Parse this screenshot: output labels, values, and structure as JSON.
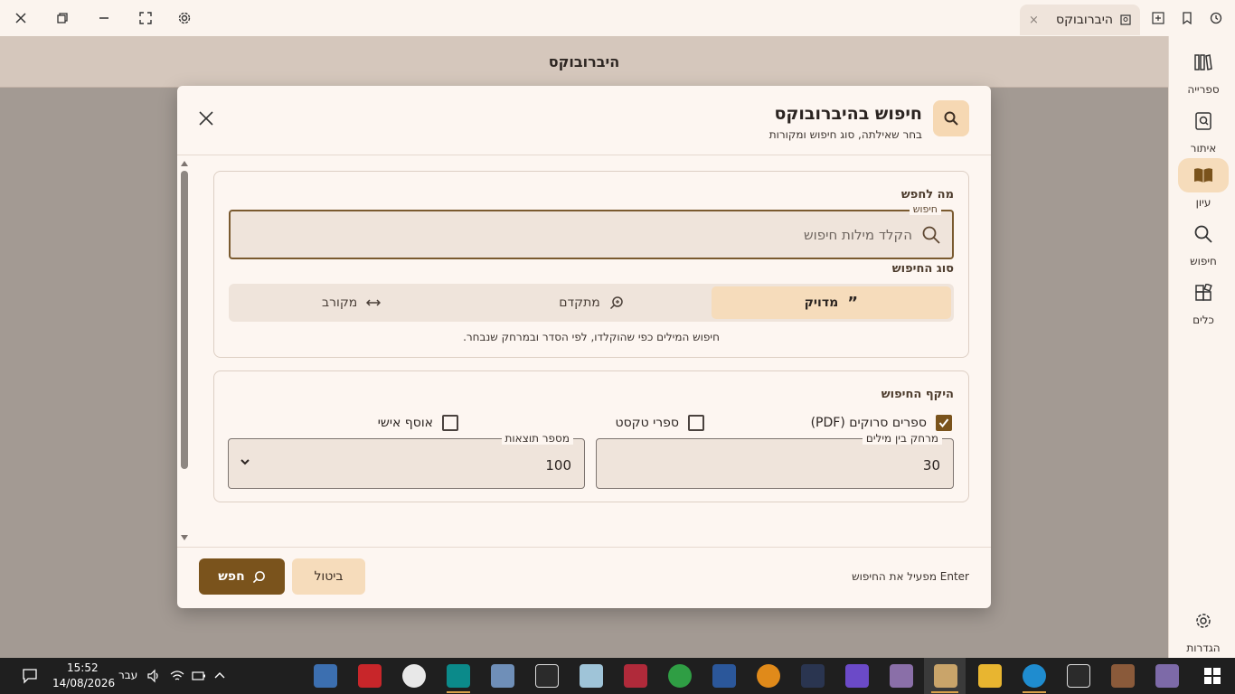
{
  "window": {
    "tab_title": "היברובוקס",
    "tab_close": "×"
  },
  "app": {
    "header_title": "היברובוקס"
  },
  "rail": {
    "items": [
      {
        "label": "ספרייה",
        "icon": "library-icon"
      },
      {
        "label": "איתור",
        "icon": "locate-icon"
      },
      {
        "label": "עיון",
        "icon": "open-book-icon",
        "active": true
      },
      {
        "label": "חיפוש",
        "icon": "search-icon"
      },
      {
        "label": "כלים",
        "icon": "tools-icon"
      }
    ],
    "settings_label": "הגדרות"
  },
  "dialog": {
    "title": "חיפוש בהיברובוקס",
    "subtitle": "בחר שאילתה, סוג חיפוש ומקורות",
    "query_section": {
      "label": "מה לחפש",
      "field_legend": "חיפוש",
      "placeholder": "הקלד מילות חיפוש",
      "value": ""
    },
    "type_section": {
      "label": "סוג החיפוש",
      "options": [
        {
          "label": "מדויק",
          "icon": "quote-icon",
          "selected": true
        },
        {
          "label": "מתקדם",
          "icon": "zoom-search-icon",
          "selected": false
        },
        {
          "label": "מקורב",
          "icon": "arrows-horizontal-icon",
          "selected": false
        }
      ],
      "help": "חיפוש המילים כפי שהוקלדו, לפי הסדר ובמרחק שנבחר."
    },
    "scope_section": {
      "label": "היקף החיפוש",
      "sources": [
        {
          "label": "ספרים סרוקים (PDF)",
          "checked": true
        },
        {
          "label": "ספרי טקסט",
          "checked": false
        },
        {
          "label": "אוסף אישי",
          "checked": false
        }
      ],
      "distance_legend": "מרחק בין מילים",
      "distance_value": "30",
      "results_legend": "מספר תוצאות",
      "results_value": "100"
    },
    "footer": {
      "hint": "Enter מפעיל את החיפוש",
      "cancel_label": "ביטול",
      "search_label": "חפש"
    }
  },
  "taskbar": {
    "time": "15:52",
    "date": "14/08/2026",
    "language": "עבר"
  },
  "colors": {
    "accent": "#7a531c",
    "accent_light": "#f6dcbb",
    "header_band": "#d5c7bc",
    "surface": "#fdf6f1"
  }
}
